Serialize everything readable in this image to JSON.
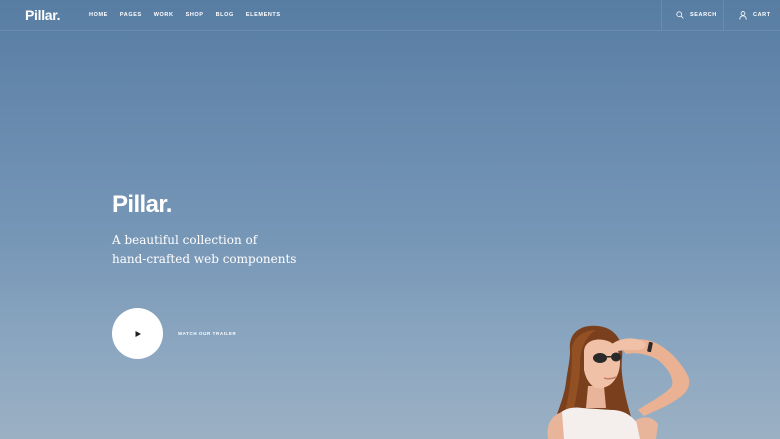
{
  "brand": {
    "logo": "Pillar."
  },
  "nav": {
    "items": [
      "HOME",
      "PAGES",
      "WORK",
      "SHOP",
      "BLOG",
      "ELEMENTS"
    ]
  },
  "header_actions": {
    "search_label": "SEARCH",
    "cart_label": "CART",
    "search_icon": "search-icon",
    "cart_icon": "user-icon"
  },
  "hero": {
    "title": "Pillar.",
    "subtitle_lines": [
      "A beautiful collection of",
      "hand-crafted web components"
    ],
    "trailer_label": "WATCH OUR TRAILER",
    "play_icon": "play-icon",
    "image": "woman-shading-eyes-photo"
  },
  "colors": {
    "sky_top": "#587da2",
    "sky_bottom": "#9bb0c3",
    "text": "#ffffff",
    "play_button": "#ffffff",
    "play_glyph": "#1f1f1f"
  }
}
